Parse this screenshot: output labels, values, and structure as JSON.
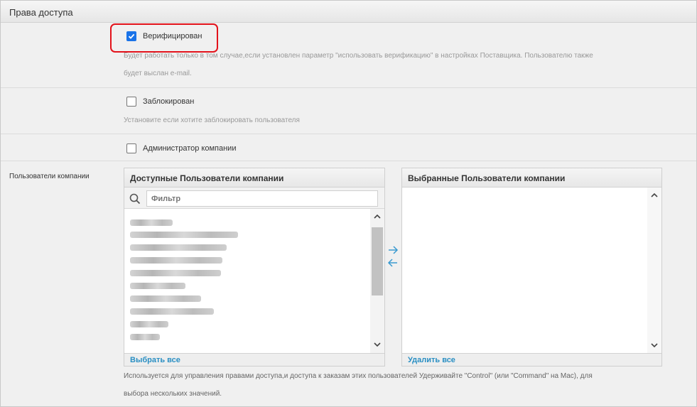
{
  "panel": {
    "title": "Права доступа"
  },
  "verified": {
    "label": "Верифицирован",
    "checked": true,
    "hint_line1": "Будет работать только в том случае,если установлен параметр \"использовать верификацию\" в настройках Поставщика. Пользователю также",
    "hint_line2": "будет выслан e-mail."
  },
  "blocked": {
    "label": "Заблокирован",
    "checked": false,
    "hint": "Установите если хотите заблокировать пользователя"
  },
  "admin": {
    "label": "Администратор компании",
    "checked": false
  },
  "company_users": {
    "label": "Пользователи компании",
    "available": {
      "title": "Доступные Пользователи компании",
      "filter_placeholder": "Фильтр",
      "select_all": "Выбрать все"
    },
    "selected": {
      "title": "Выбранные Пользователи компании",
      "remove_all": "Удалить все"
    },
    "hint_line1": "Используется для управления правами доступа,и доступа к заказам этих пользователей Удерживайте \"Control\" (или \"Command\" на Mac), для",
    "hint_line2": "выбора нескольких значений."
  },
  "colors": {
    "accent": "#1a73e8",
    "link": "#2a8fc3",
    "highlight": "#e3121b"
  }
}
